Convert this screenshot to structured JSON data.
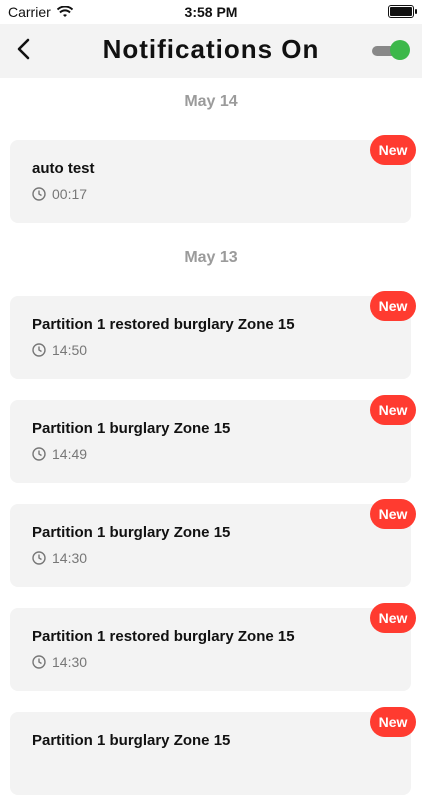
{
  "status_bar": {
    "carrier": "Carrier",
    "time": "3:58 PM"
  },
  "header": {
    "title": "Notifications On",
    "toggle_on": true
  },
  "groups": [
    {
      "date": "May 14",
      "items": [
        {
          "title": "auto test",
          "time": "00:17",
          "badge": "New"
        }
      ]
    },
    {
      "date": "May 13",
      "items": [
        {
          "title": "Partition 1 restored burglary Zone 15",
          "time": "14:50",
          "badge": "New"
        },
        {
          "title": "Partition 1 burglary Zone 15",
          "time": "14:49",
          "badge": "New"
        },
        {
          "title": "Partition 1 burglary Zone 15",
          "time": "14:30",
          "badge": "New"
        },
        {
          "title": "Partition 1 restored burglary Zone 15",
          "time": "14:30",
          "badge": "New"
        },
        {
          "title": "Partition 1 burglary Zone 15",
          "time": "",
          "badge": "New"
        }
      ]
    }
  ],
  "colors": {
    "accent_green": "#3cb84a",
    "badge_red": "#ff3b30",
    "card_bg": "#f3f3f3",
    "date_gray": "#9b9b9b"
  }
}
